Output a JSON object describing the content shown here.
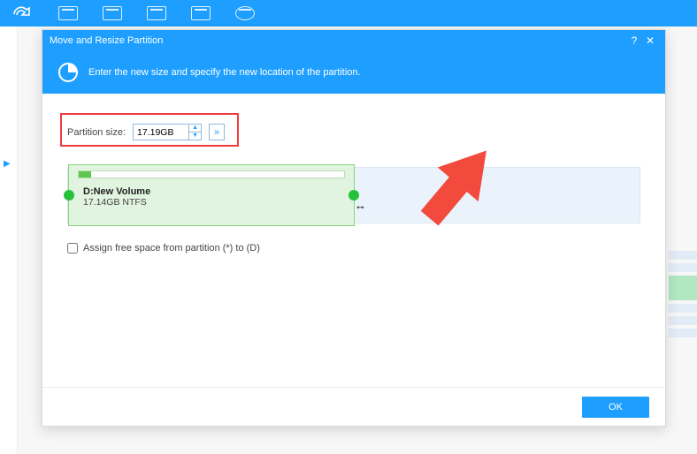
{
  "dialog": {
    "title": "Move and Resize Partition",
    "banner_text": "Enter the new size and specify the new location of the partition."
  },
  "partition_size": {
    "label": "Partition size:",
    "value": "17.19GB"
  },
  "partition": {
    "name": "D:New Volume",
    "info": "17.14GB NTFS"
  },
  "assign": {
    "label": "Assign free space from partition (*) to (D)",
    "checked": false
  },
  "buttons": {
    "ok": "OK"
  },
  "icons": {
    "help": "?",
    "close": "✕",
    "expander": "»",
    "spin_up": "▲",
    "spin_down": "▼",
    "chev": "▶",
    "resize": "↔"
  }
}
